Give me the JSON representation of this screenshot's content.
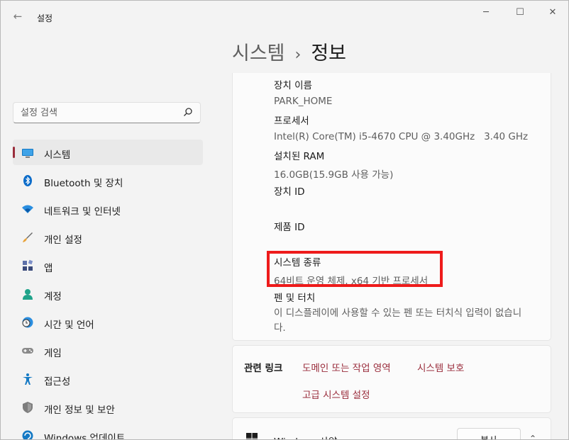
{
  "window": {
    "app_title": "설정",
    "back_icon": "←",
    "minimize_icon": "─",
    "maximize_icon": "☐",
    "close_icon": "✕"
  },
  "breadcrumb": {
    "parent": "시스템",
    "separator": "›",
    "current": "정보"
  },
  "search": {
    "placeholder": "설정 검색"
  },
  "sidebar": {
    "items": [
      {
        "label": "시스템",
        "selected": true
      },
      {
        "label": "Bluetooth 및 장치"
      },
      {
        "label": "네트워크 및 인터넷"
      },
      {
        "label": "개인 설정"
      },
      {
        "label": "앱"
      },
      {
        "label": "계정"
      },
      {
        "label": "시간 및 언어"
      },
      {
        "label": "게임"
      },
      {
        "label": "접근성"
      },
      {
        "label": "개인 정보 및 보안"
      },
      {
        "label": "Windows 업데이트"
      }
    ]
  },
  "device_specs": [
    {
      "label": "장치 이름",
      "value": "PARK_HOME"
    },
    {
      "label": "프로세서",
      "value": "Intel(R) Core(TM) i5-4670 CPU @ 3.40GHz   3.40 GHz"
    },
    {
      "label": "설치된 RAM",
      "value": "16.0GB(15.9GB 사용 가능)"
    },
    {
      "label": "장치 ID",
      "value": ""
    },
    {
      "label": "제품 ID",
      "value": ""
    },
    {
      "label": "시스템 종류",
      "value": "64비트 운영 체제, x64 기반 프로세서"
    },
    {
      "label": "펜 및 터치",
      "value": "이 디스플레이에 사용할 수 있는 펜 또는 터치식 입력이 없습니다."
    }
  ],
  "related_links": {
    "title": "관련 링크",
    "links": [
      "도메인 또는 작업 영역",
      "시스템 보호",
      "고급 시스템 설정"
    ]
  },
  "windows_spec": {
    "label": "Windows 사양",
    "copy_label": "복사",
    "chevron": "⌃"
  },
  "colors": {
    "accent": "#9a2d3c",
    "highlight_box": "#ee1b1b",
    "window_bg": "#f3f3f3",
    "card_bg": "#fbfbfb"
  }
}
